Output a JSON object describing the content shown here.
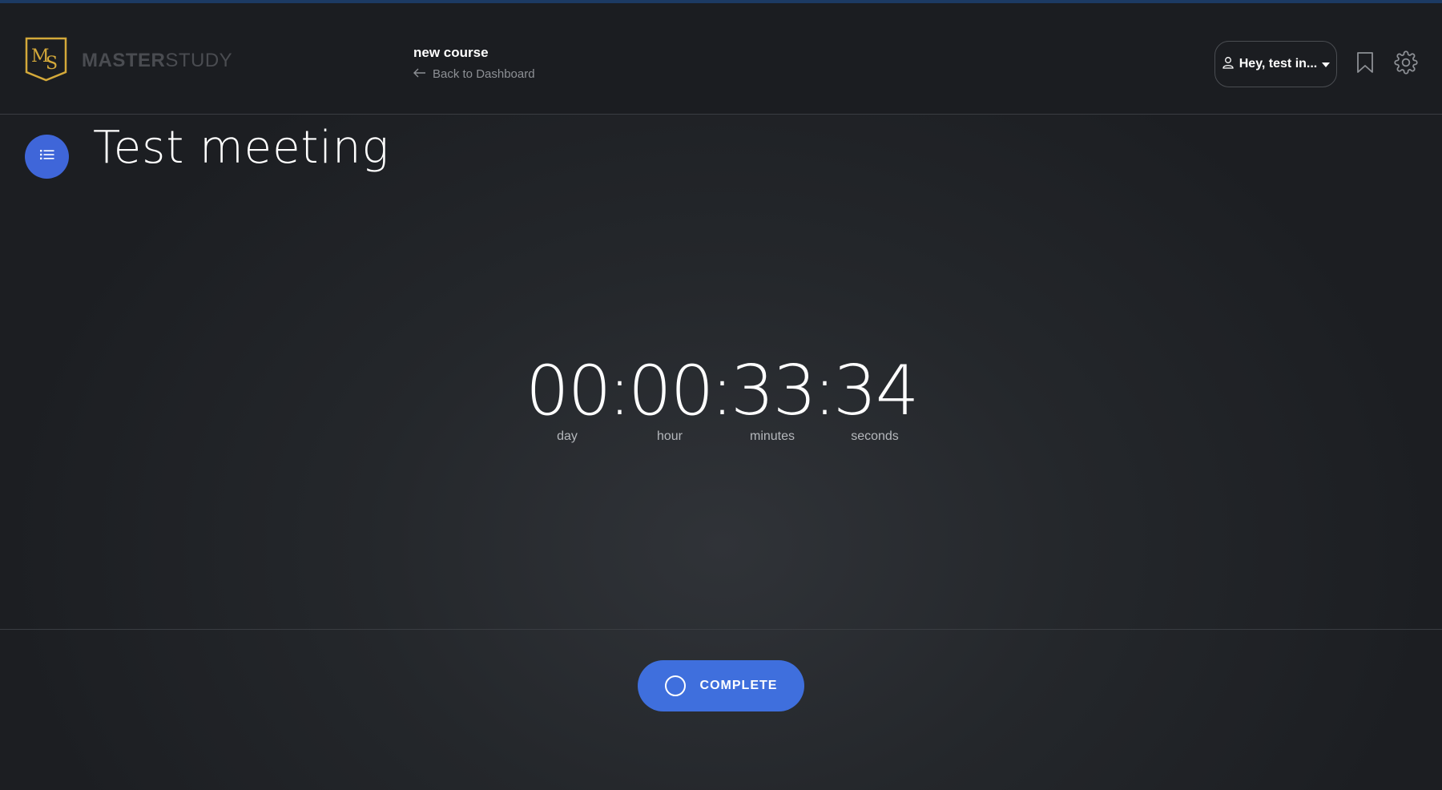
{
  "header": {
    "brand_bold": "MASTER",
    "brand_light": "STUDY",
    "course_title": "new course",
    "back_link": "Back to Dashboard",
    "user_menu_label": "Hey, test in...",
    "icons": [
      "logo-icon",
      "arrow-left-icon",
      "user-icon",
      "caret-down-icon",
      "bookmark-icon",
      "gear-icon"
    ]
  },
  "lesson": {
    "title": "Test meeting"
  },
  "countdown": {
    "day": "00",
    "hour": "00",
    "minutes": "33",
    "seconds": "34",
    "day_label": "day",
    "hour_label": "hour",
    "minutes_label": "minutes",
    "seconds_label": "seconds"
  },
  "footer": {
    "complete_label": "COMPLETE"
  },
  "colors": {
    "accent_blue": "#3f6fdd",
    "logo_gold": "#d4a93a",
    "background": "#24272b"
  }
}
